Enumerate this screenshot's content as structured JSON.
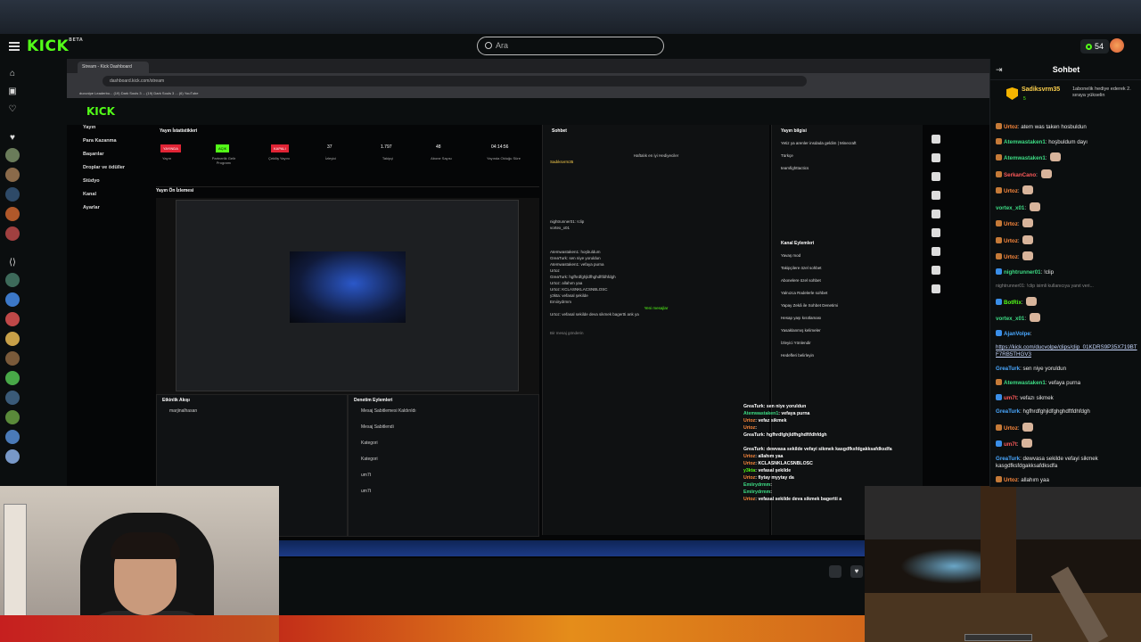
{
  "header": {
    "logo": "KICK",
    "logo_tag": "BETA",
    "search_placeholder": "Ara",
    "points": "54"
  },
  "colors": {
    "brand": "#53fc18",
    "live_red": "#e02435",
    "bg": "#0b0e0f"
  },
  "stream_frame": {
    "browser_tab": "Stream - Kick Dashboard",
    "url": "dashboard.kick.com/stream",
    "bookmarks": "ducvolpe Leaderbo...   (19) Dark Souls 3 ...   (19) Dark Souls 3 ...   (6) YouTube",
    "inner_logo": "KICK",
    "sidebar": [
      "Yayın",
      "Para Kazanma",
      "Başarılar",
      "Droplar ve ödüller",
      "Stüdyo",
      "Kanal",
      "Ayarlar"
    ],
    "stats_title": "Yayın İstatistikleri",
    "stats": [
      {
        "value": "YAYINDA",
        "label": "Yayın"
      },
      {
        "value": "AÇIK",
        "label": "Partnerlik Gelir Programı"
      },
      {
        "value": "KAPALI",
        "label": "Çekiliş Yayını"
      },
      {
        "value": "37",
        "label": "İzleyici"
      },
      {
        "value": "1.797",
        "label": "Takipçi"
      },
      {
        "value": "48",
        "label": "Abone Sayısı"
      },
      {
        "value": "04:14:56",
        "label": "Yayında Olduğu Süre"
      }
    ],
    "preview_title": "Yayın Ön İzlemesi",
    "activity_title": "Etkinlik Akışı",
    "activity_filter": "Filtre",
    "activity_rows": [
      "marjinalhasan",
      "",
      "",
      ""
    ],
    "mod_title": "Denetim Eylemleri",
    "mod_filter": "Filtre",
    "mod_rows": [
      "Mesaj Sabitlemesi Kaldırıldı",
      "Mesaj Sabitlendi",
      "Kategori",
      "Kategori",
      "um7t",
      "um7t"
    ],
    "chat_title": "Sohbet",
    "chat_subtitle": "Haftalık en iyi Hediyeciler",
    "chat_lines": [
      "Sadıksvrm35",
      "nightrunner01: !clip",
      "vortex_x01",
      "Atemwastaken1: hoşbuldum",
      "GreaTurk: sen niye yoruldun",
      "Atemwastaken1: vefaya purna",
      "Urtoz",
      "GreaTurk: hgfhrdfghjldfhghdftfdhfdgh",
      "Urtoz: allahım yaa",
      "Urtoz: KCLASNKLACSNBLOSC",
      "y3kta: vefasal şekilde",
      "Emiirydrmm",
      "Yeni mesajlar",
      "Urtoz: vefasal sekilde deva sikmek bagertti ank ya"
    ],
    "chat_input": "Bir mesaj gönderin",
    "info_title": "Yayın bilgisi",
    "info_desc": "Yetiz ya arenler insdada geldim | Minecraft",
    "info_tags": [
      "Türkçe",
      "teamfighttactics"
    ],
    "channel_title": "Kanal Eylemleri",
    "channel_rows": [
      "Yavaş mod",
      "Takipçilere özel sohbet",
      "Abonelere özel sohbet",
      "Yalnızca Rədelerle sohbet",
      "Yapay Zekâ ile Sohbet Denetimi",
      "Hesap yaşı kısıtlaması",
      "Yasaklanmış kelimeler",
      "İzleyici Yönlendir",
      "Hedefleri belirleyin"
    ]
  },
  "overlay_chat": [
    {
      "user": "GreaTurk",
      "text": "sen niye yoruldun",
      "color": "#ffffff"
    },
    {
      "user": "Atemwastaken1",
      "text": "vefaya purna",
      "color": "#3ddc84"
    },
    {
      "user": "Urtoz",
      "text": "vefaz sikmek",
      "color": "#ffffff"
    },
    {
      "user": "Urtoz",
      "text": "",
      "color": "#ff8a3d"
    },
    {
      "user": "GreaTurk",
      "text": "hgfhrdfghjldfhghdftfdhfdgh",
      "color": "#ffffff"
    },
    {
      "user": "",
      "text": "",
      "color": "#ff4b4b"
    },
    {
      "user": "GreaTurk",
      "text": "dewvasa sekilde vefayi sikmek kasgdfksfdgakksafdksdfa",
      "color": "#ffffff"
    },
    {
      "user": "Urtoz",
      "text": "allahım yaa",
      "color": "#ff8a3d"
    },
    {
      "user": "Urtoz",
      "text": "KCLASNKLACSNBLOSC",
      "color": "#ff8a3d"
    },
    {
      "user": "y3kta",
      "text": "vefasal şekilde",
      "color": "#53fc18"
    },
    {
      "user": "Urtoz",
      "text": "fiytay myytay da",
      "color": "#ff8a3d"
    },
    {
      "user": "Emiirydrmm",
      "text": "",
      "color": "#3ddc84"
    },
    {
      "user": "Emiirydrmm",
      "text": "",
      "color": "#3ddc84"
    },
    {
      "user": "Urtoz",
      "text": "vefasal sekilde deva sikmek bagertti a",
      "color": "#ff8a3d"
    }
  ],
  "right_chat": {
    "title": "Sohbet",
    "pinned_user": "Sadiksvrm35",
    "pinned_count": "5",
    "pinned_text": "1abonelik hediye ederek 2. sıraya yükselin",
    "messages": [
      {
        "user": "Urtoz",
        "sep": ":",
        "text": "atem was taken hosbuldun",
        "color": "#ff8a3d",
        "badge": "#c57a38"
      },
      {
        "user": "Atemwastaken1",
        "sep": ":",
        "text": "hoşbuldum dayı",
        "color": "#3ddc84",
        "badge": "#c57a38"
      },
      {
        "user": "Atemwastaken1",
        "sep": ":",
        "text": "",
        "color": "#3ddc84",
        "badge": "#c57a38",
        "emote": true
      },
      {
        "user": "SerkanCano",
        "sep": ":",
        "text": "",
        "color": "#ff5a5a",
        "badge": "#c57a38",
        "emote": true
      },
      {
        "user": "Urtoz",
        "sep": ":",
        "text": "",
        "color": "#ff8a3d",
        "badge": "#c57a38",
        "emote": true
      },
      {
        "user": "vortex_x01",
        "sep": ":",
        "text": "",
        "color": "#3ddc84",
        "badge": "",
        "emote": true
      },
      {
        "user": "Urtoz",
        "sep": ":",
        "text": "",
        "color": "#ff8a3d",
        "badge": "#c57a38",
        "emote": true
      },
      {
        "user": "Urtoz",
        "sep": ":",
        "text": "",
        "color": "#ff8a3d",
        "badge": "#c57a38",
        "emote": true
      },
      {
        "user": "Urtoz",
        "sep": ":",
        "text": "",
        "color": "#ff8a3d",
        "badge": "#c57a38",
        "emote": true
      },
      {
        "user": "nightrunner01",
        "sep": ":",
        "text": "!clip",
        "color": "#3ddc84",
        "badge": "#3a8ee8"
      },
      {
        "user": "",
        "sep": "",
        "text": "nightrunner01: !clip isimli kullanıcıya yanıt veri...",
        "color": "#888888",
        "badge": "",
        "reply": true
      },
      {
        "user": "BotRix",
        "sep": ":",
        "text": "",
        "color": "#53fc18",
        "badge": "#3a8ee8",
        "emote": true
      },
      {
        "user": "vortex_x01",
        "sep": ":",
        "text": "",
        "color": "#3ddc84",
        "badge": "",
        "emote": true
      },
      {
        "user": "AjanVolpe",
        "sep": ":",
        "text": "",
        "color": "#4aa8ff",
        "badge": "#3a8ee8"
      },
      {
        "user": "",
        "sep": "",
        "text": "https://kick.com/ducvolpe/clips/clip_01KDRS9P35X719BTF7RB5THGV3",
        "color": "#c8d8ff",
        "badge": "",
        "link": true
      },
      {
        "user": "GreaTurk",
        "sep": ":",
        "text": "sen niye yoruldun",
        "color": "#4aa8ff",
        "badge": ""
      },
      {
        "user": "Atemwastaken1",
        "sep": ":",
        "text": "vefaya purna",
        "color": "#3ddc84",
        "badge": "#c57a38"
      },
      {
        "user": "um7t",
        "sep": ":",
        "text": "vefazı sikmek",
        "color": "#ff5a5a",
        "badge": "#3a8ee8"
      },
      {
        "user": "GreaTurk",
        "sep": ":",
        "text": "hgfhrdfghjldfghghdftfdhfdgh",
        "color": "#4aa8ff",
        "badge": ""
      },
      {
        "user": "Urtoz",
        "sep": ":",
        "text": "",
        "color": "#ff8a3d",
        "badge": "#c57a38",
        "emote": true
      },
      {
        "user": "um7t",
        "sep": ":",
        "text": "",
        "color": "#ff5a5a",
        "badge": "#3a8ee8",
        "emote": true
      },
      {
        "user": "GreaTurk",
        "sep": ":",
        "text": "dewvasa sekilde vefayi sikmek kasgdfksfdgakksafdksdfa",
        "color": "#4aa8ff",
        "badge": "",
        "wrap": true
      },
      {
        "user": "Urtoz",
        "sep": ":",
        "text": "allahım yaa",
        "color": "#ff8a3d",
        "badge": "#c57a38"
      },
      {
        "user": "Urtoz",
        "sep": ":",
        "text": "KCLASNKLACSNBLOSC",
        "color": "#ff8a3d",
        "badge": "#c57a38"
      },
      {
        "user": "y3kta",
        "sep": ":",
        "text": "vefasal şekilde",
        "color": "#53fc18",
        "badge": "#c57a38"
      },
      {
        "user": "Urtoz",
        "sep": ":",
        "text": "fiytay myytay da",
        "color": "#ff8a3d",
        "badge": "#c57a38"
      }
    ]
  }
}
